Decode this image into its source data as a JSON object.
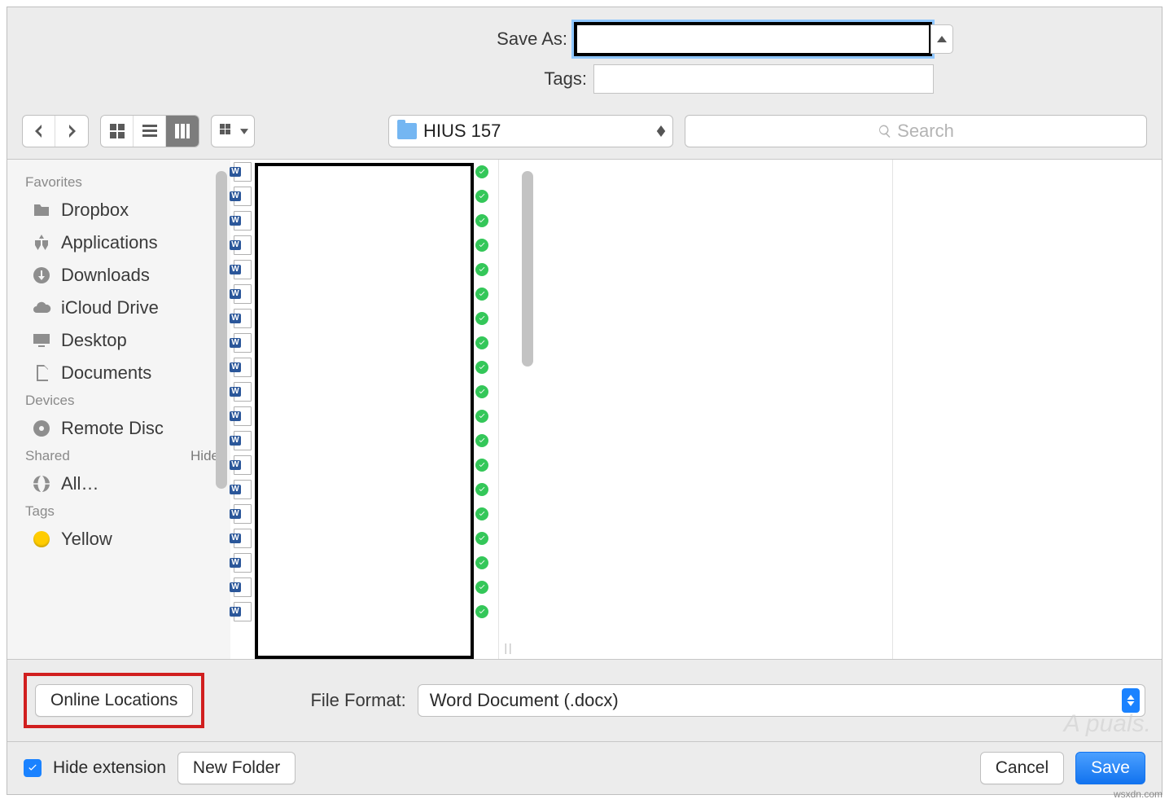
{
  "top_form": {
    "save_as_label": "Save As:",
    "tags_label": "Tags:",
    "save_as_value": "",
    "tags_value": ""
  },
  "toolbar": {
    "location_name": "HIUS 157",
    "search_placeholder": "Search"
  },
  "sidebar": {
    "groups": [
      {
        "title": "Favorites",
        "hide_label": "",
        "items": [
          {
            "label": "Dropbox",
            "icon": "folder"
          },
          {
            "label": "Applications",
            "icon": "apps"
          },
          {
            "label": "Downloads",
            "icon": "downloads"
          },
          {
            "label": "iCloud Drive",
            "icon": "cloud"
          },
          {
            "label": "Desktop",
            "icon": "desktop"
          },
          {
            "label": "Documents",
            "icon": "documents"
          }
        ]
      },
      {
        "title": "Devices",
        "hide_label": "",
        "items": [
          {
            "label": "Remote Disc",
            "icon": "disc"
          }
        ]
      },
      {
        "title": "Shared",
        "hide_label": "Hide",
        "items": [
          {
            "label": "All…",
            "icon": "network"
          }
        ]
      },
      {
        "title": "Tags",
        "hide_label": "",
        "items": [
          {
            "label": "Yellow",
            "icon": "tag-yellow"
          }
        ]
      }
    ]
  },
  "file_list_count": 19,
  "format_row": {
    "online_locations_label": "Online Locations",
    "format_label": "File Format:",
    "format_value": "Word Document (.docx)"
  },
  "bottom_bar": {
    "hide_ext_label": "Hide extension",
    "hide_ext_checked": true,
    "new_folder_label": "New Folder",
    "cancel_label": "Cancel",
    "save_label": "Save"
  },
  "watermark_text": "A puals.",
  "source_text": "wsxdn.com"
}
